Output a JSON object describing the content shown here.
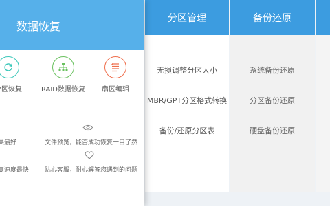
{
  "panel": {
    "title": "数据恢复",
    "features": [
      {
        "label": "分区恢复",
        "icon": "refresh-icon",
        "color": "#3bc7b9"
      },
      {
        "label": "RAID数据恢复",
        "icon": "raid-network-icon",
        "color": "#6ac15f"
      },
      {
        "label": "扇区编辑",
        "icon": "sector-edit-icon",
        "color": "#ef6f4d"
      }
    ],
    "notes": [
      "果最好",
      "文件预览，能否成功恢复一目了然",
      "复速度最快",
      "贴心客服，耐心解答您遇到的问题"
    ]
  },
  "columns": {
    "partition": {
      "title": "分区管理",
      "items": [
        "无损调整分区大小",
        "MBR/GPT分区格式转换",
        "备份/还原分区表"
      ]
    },
    "backup": {
      "title": "备份还原",
      "items": [
        "系统备份还原",
        "分区备份还原",
        "硬盘备份还原"
      ]
    }
  },
  "colors": {
    "panel_header": "#56b0ea",
    "column_header": "#3c9ce0"
  }
}
